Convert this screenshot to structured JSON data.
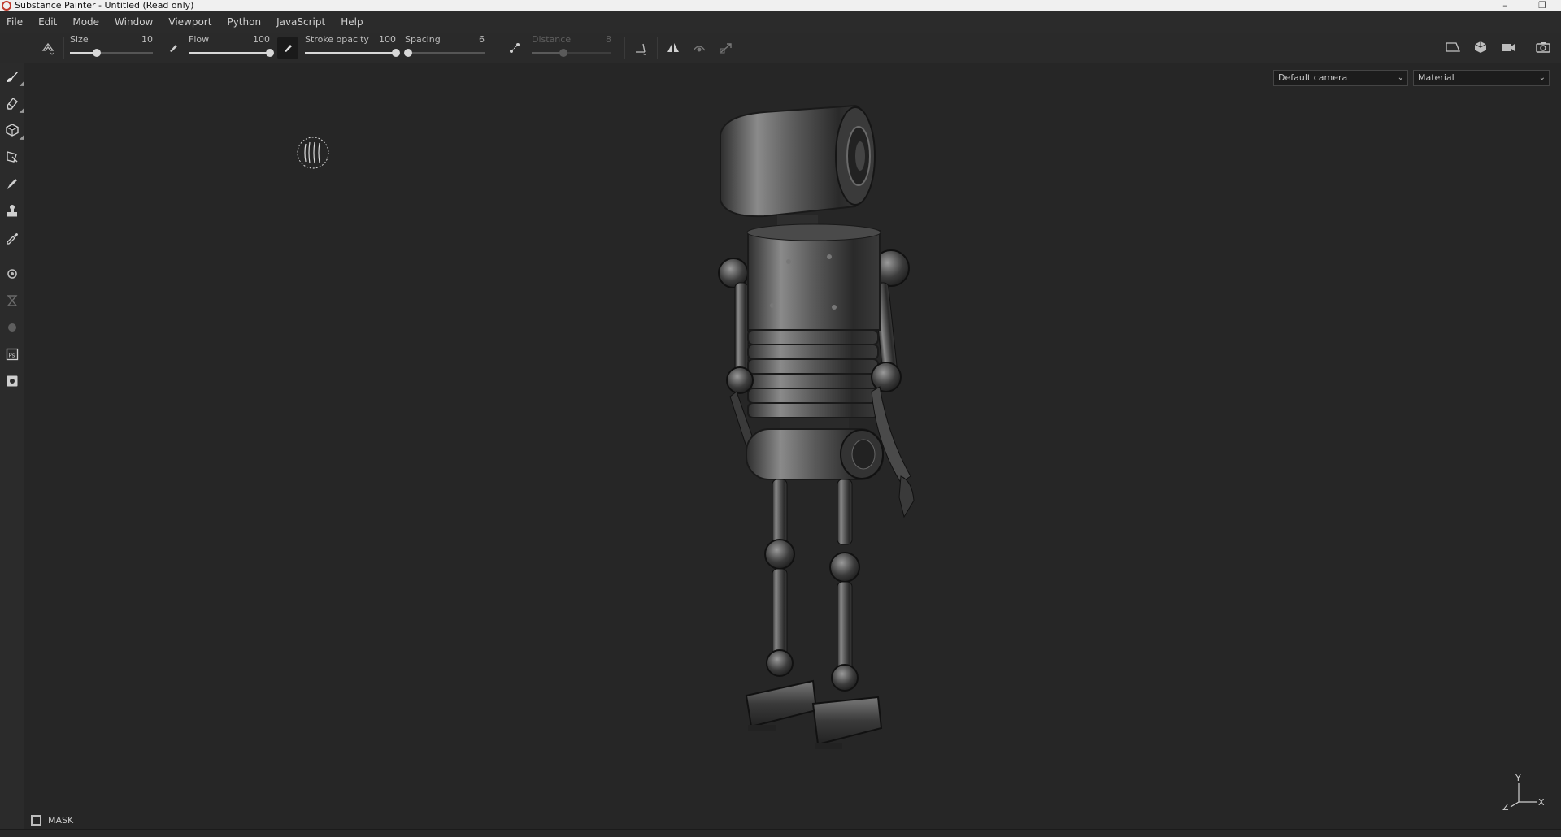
{
  "window": {
    "title": "Substance Painter - Untitled (Read only)",
    "minimize_glyph": "–",
    "restore_glyph": "❐"
  },
  "menu": [
    "File",
    "Edit",
    "Mode",
    "Window",
    "Viewport",
    "Python",
    "JavaScript",
    "Help"
  ],
  "toolbar": {
    "size": {
      "label": "Size",
      "value": "10",
      "fraction": 0.32
    },
    "flow": {
      "label": "Flow",
      "value": "100",
      "fraction": 1.0
    },
    "stroke_opacity": {
      "label": "Stroke opacity",
      "value": "100",
      "fraction": 1.0
    },
    "spacing": {
      "label": "Spacing",
      "value": "6",
      "fraction": 0.04
    },
    "distance": {
      "label": "Distance",
      "value": "8",
      "fraction": 0.4,
      "disabled": true
    }
  },
  "viewport": {
    "camera_select": "Default camera",
    "display_select": "Material",
    "axis_labels": {
      "x": "X",
      "y": "Y",
      "z": "Z"
    }
  },
  "mask": {
    "label": "MASK"
  },
  "icons": {
    "left_tools": [
      "paint-brush-icon",
      "eraser-icon",
      "projection-icon",
      "polygon-fill-icon",
      "smudge-icon",
      "clone-stamp-icon",
      "color-picker-icon",
      "bake-settings-icon",
      "hourglass-icon",
      "sphere-icon",
      "photoshop-export-icon",
      "screenshot-icon"
    ],
    "right_tools": [
      "viewport-frame-icon",
      "3d-cube-icon",
      "camera-icon",
      "screenshot-camera-icon"
    ]
  },
  "colors": {
    "background": "#262626",
    "panel": "#2b2b2b",
    "accent_brand": "#c0392b"
  }
}
